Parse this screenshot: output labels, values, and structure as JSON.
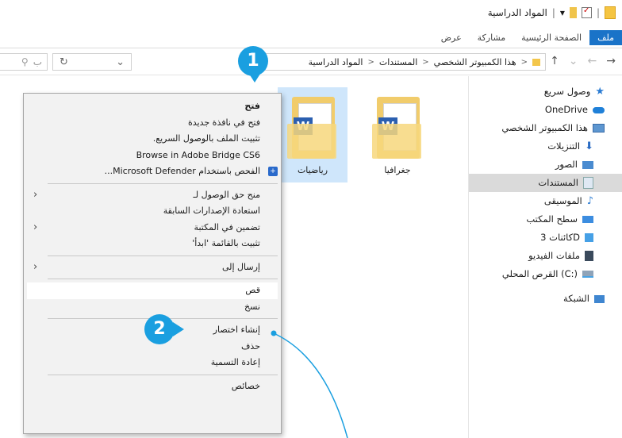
{
  "window": {
    "title": "المواد الدراسية",
    "quick_access_separator": "|",
    "quick_access_dropdown": "▾"
  },
  "ribbon": {
    "tabs": [
      {
        "label": "ملف",
        "active": true
      },
      {
        "label": "الصفحة الرئيسية",
        "active": false
      },
      {
        "label": "مشاركة",
        "active": false
      },
      {
        "label": "عرض",
        "active": false
      }
    ]
  },
  "navigation": {
    "back": "←",
    "forward": "→",
    "recent": "⌄",
    "up": "↑"
  },
  "address_bar": {
    "separator": ">",
    "segments": [
      "هذا الكمبيوتر الشخصي",
      "المستندات",
      "المواد الدراسية"
    ]
  },
  "toolbar": {
    "refresh": "↻",
    "dropdown": "⌄",
    "search_icon": "⚲",
    "search_placeholder": "ب"
  },
  "nav_pane": {
    "items": [
      {
        "label": "وصول سريع",
        "icon": "star-icon",
        "indent": 0
      },
      {
        "label": "OneDrive",
        "icon": "cloud-icon",
        "indent": 0
      },
      {
        "label": "هذا الكمبيوتر الشخصي",
        "icon": "computer-icon",
        "indent": 0
      },
      {
        "label": "التنزيلات",
        "icon": "download-icon",
        "indent": 1
      },
      {
        "label": "الصور",
        "icon": "pictures-icon",
        "indent": 1
      },
      {
        "label": "المستندات",
        "icon": "documents-icon",
        "indent": 1,
        "selected": true
      },
      {
        "label": "الموسيقى",
        "icon": "music-icon",
        "indent": 1
      },
      {
        "label": "سطح المكتب",
        "icon": "desktop-icon",
        "indent": 1
      },
      {
        "label": "كائنات 3D",
        "icon": "3d-objects-icon",
        "indent": 1
      },
      {
        "label": "ملفات الفيديو",
        "icon": "video-icon",
        "indent": 1
      },
      {
        "label": "القرص المحلي (C:)",
        "icon": "drive-icon",
        "indent": 1
      },
      {
        "label": "الشبكة",
        "icon": "network-icon",
        "indent": 0
      }
    ]
  },
  "files": [
    {
      "name": "جغرافيا",
      "type": "word-folder",
      "selected": false
    },
    {
      "name": "رياضيات",
      "type": "word-folder",
      "selected": true
    }
  ],
  "context_menu": {
    "groups": [
      [
        {
          "label": "فتح",
          "bold": true
        },
        {
          "label": "فتح في نافذة جديدة"
        },
        {
          "label": "تثبيت الملف بالوصول السريع."
        },
        {
          "label": "Browse in Adobe Bridge CS6"
        },
        {
          "label": "الفحص باستخدام Microsoft Defender...",
          "icon": "defender-shield-icon"
        }
      ],
      [
        {
          "label": "منح حق الوصول لـ",
          "submenu": true
        },
        {
          "label": "استعادة الإصدارات السابقة"
        },
        {
          "label": "تضمين في المكتبة",
          "submenu": true
        },
        {
          "label": "تثبيت بالقائمة 'ابدأ'"
        }
      ],
      [
        {
          "label": "إرسال إلى",
          "submenu": true
        }
      ],
      [
        {
          "label": "قص",
          "highlighted": true
        },
        {
          "label": "نسخ"
        }
      ],
      [
        {
          "label": "إنشاء اختصار"
        },
        {
          "label": "حذف"
        },
        {
          "label": "إعادة التسمية"
        }
      ],
      [
        {
          "label": "خصائص"
        }
      ]
    ],
    "submenu_arrow": "‹",
    "defender_glyph": "+"
  },
  "callouts": [
    {
      "number": "1"
    },
    {
      "number": "2"
    }
  ],
  "colors": {
    "accent": "#1a73c8",
    "callout": "#1a9fe0",
    "selection": "#cfe6fb",
    "folder": "#f1cc6b"
  }
}
